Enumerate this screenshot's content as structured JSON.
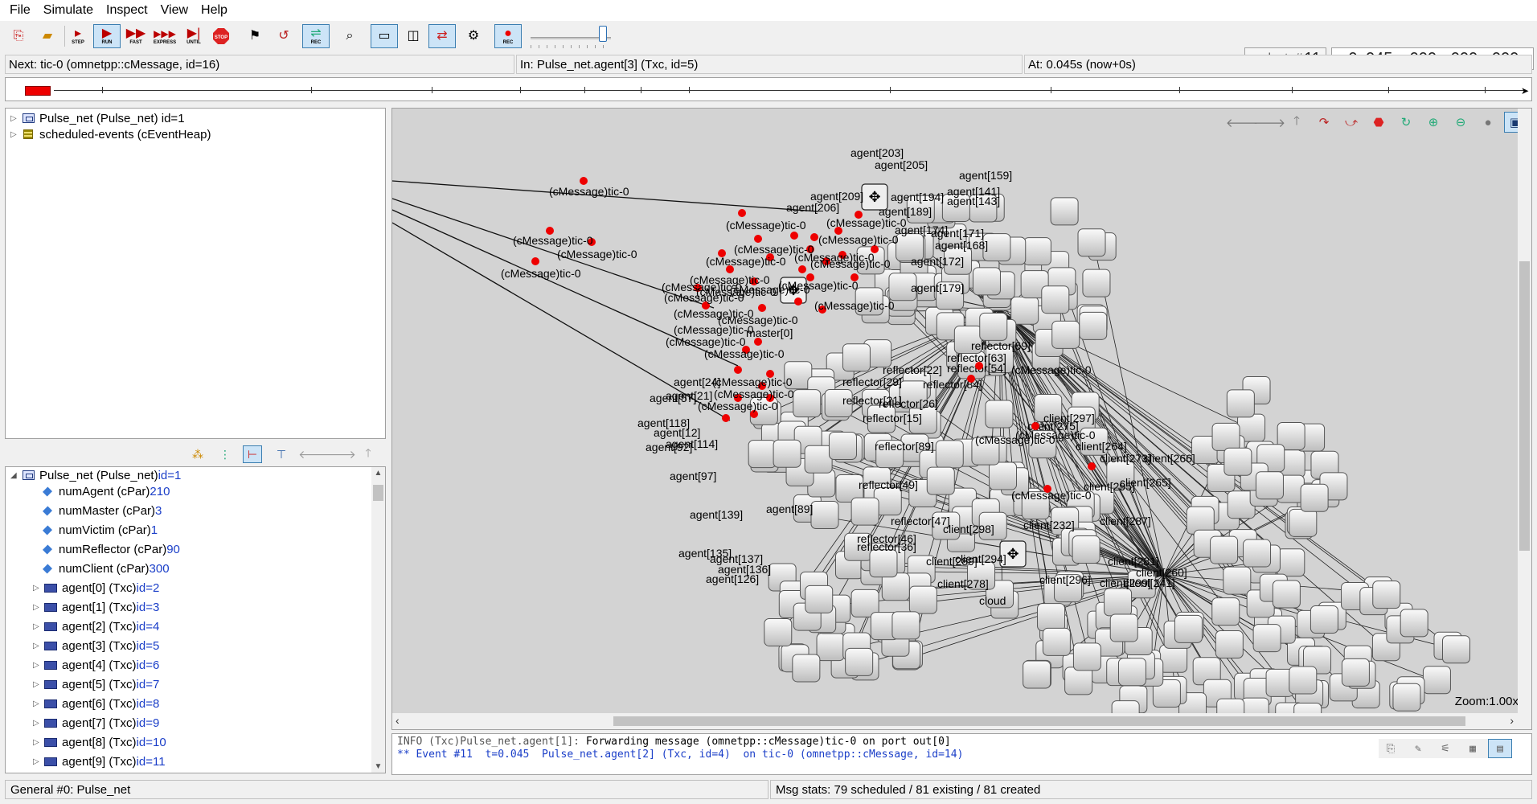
{
  "menu": [
    "File",
    "Simulate",
    "Inspect",
    "View",
    "Help"
  ],
  "toolbar": {
    "step": "STEP",
    "run": "RUN",
    "fast": "FAST",
    "express": "EXPRESS",
    "until": "UNTIL",
    "stop": "STOP",
    "rec": "REC",
    "rec2": "REC",
    "last_prefix": "last: #",
    "last_num": "11",
    "time": {
      "s": "0",
      "s_u": "s",
      "ms": "045",
      "ms_u": "ms",
      "us": "000",
      "us_u": "us",
      "ns": "000",
      "ns_u": "ns",
      "ps": "000",
      "ps_u": "ps"
    }
  },
  "info": {
    "next": "Next: tic-0 (omnetpp::cMessage, id=16)",
    "in": "In: Pulse_net.agent[3] (Txc, id=5)",
    "at": "At: 0.045s (now+0s)"
  },
  "tree_top": [
    {
      "label": "Pulse_net (Pulse_net) id=1",
      "icon": "network-icon"
    },
    {
      "label": "scheduled-events (cEventHeap)",
      "icon": "event-heap-icon"
    }
  ],
  "tree_bottom": {
    "root": {
      "label": "Pulse_net (Pulse_net) ",
      "id": "id=1"
    },
    "params": [
      {
        "name": "numAgent (cPar) ",
        "value": "210"
      },
      {
        "name": "numMaster (cPar) ",
        "value": "3"
      },
      {
        "name": "numVictim (cPar) ",
        "value": "1"
      },
      {
        "name": "numReflector (cPar) ",
        "value": "90"
      },
      {
        "name": "numClient (cPar) ",
        "value": "300"
      }
    ],
    "modules": [
      {
        "name": "agent[0] (Txc) ",
        "id": "id=2"
      },
      {
        "name": "agent[1] (Txc) ",
        "id": "id=3"
      },
      {
        "name": "agent[2] (Txc) ",
        "id": "id=4"
      },
      {
        "name": "agent[3] (Txc) ",
        "id": "id=5"
      },
      {
        "name": "agent[4] (Txc) ",
        "id": "id=6"
      },
      {
        "name": "agent[5] (Txc) ",
        "id": "id=7"
      },
      {
        "name": "agent[6] (Txc) ",
        "id": "id=8"
      },
      {
        "name": "agent[7] (Txc) ",
        "id": "id=9"
      },
      {
        "name": "agent[8] (Txc) ",
        "id": "id=10"
      },
      {
        "name": "agent[9] (Txc) ",
        "id": "id=11"
      }
    ]
  },
  "canvas": {
    "zoom": "Zoom:1.00x",
    "message_label": "(cMessage)tic-0",
    "node_labels": [
      "agent[203]",
      "agent[205]",
      "agent[209]",
      "agent[206]",
      "agent[194]",
      "agent[174]",
      "agent[189]",
      "agent[159]",
      "agent[141]",
      "agent[143]",
      "agent[171]",
      "agent[168]",
      "agent[172]",
      "agent[179]",
      "master[0]",
      "reflector[29]",
      "reflector[22]",
      "reflector[21]",
      "reflector[26]",
      "reflector[15]",
      "reflector[84]",
      "reflector[69]",
      "reflector[63]",
      "reflector[54]",
      "reflector[89]",
      "reflector[49]",
      "reflector[47]",
      "reflector[46]",
      "reflector[36]",
      "agent[118]",
      "agent[92]",
      "agent[97]",
      "agent[139]",
      "agent[89]",
      "agent[135]",
      "agent[137]",
      "agent[136]",
      "agent[126]",
      "client[297]",
      "client[275]",
      "client[273]",
      "client[266]",
      "client[265]",
      "client[264]",
      "client[295]",
      "client[287]",
      "client[281]",
      "client[260]",
      "client[298]",
      "client[294]",
      "client[289]",
      "client[278]",
      "client[296]",
      "client[299]",
      "client[232]",
      "client[241]",
      "cloud",
      "agent[24]",
      "agent[21]",
      "agent[57]",
      "agent[12]",
      "agent[114]"
    ],
    "message_count_visible": 60
  },
  "log": {
    "line1_prefix": "INFO (Txc)Pulse_net.agent[1]: ",
    "line1_text": "Forwarding message (omnetpp::cMessage)tic-0 on port out[0]",
    "line2": "** Event #11  t=0.045  Pulse_net.agent[2] (Txc, id=4)  on tic-0 (omnetpp::cMessage, id=14)"
  },
  "status": {
    "left": "General #0: Pulse_net",
    "right": "Msg stats: 79 scheduled / 81 existing / 81 created"
  },
  "colors": {
    "accent": "#cce4f7",
    "message": "#ee0000",
    "canvas_bg": "#d3d3d3",
    "id_blue": "#1a3ec8"
  }
}
